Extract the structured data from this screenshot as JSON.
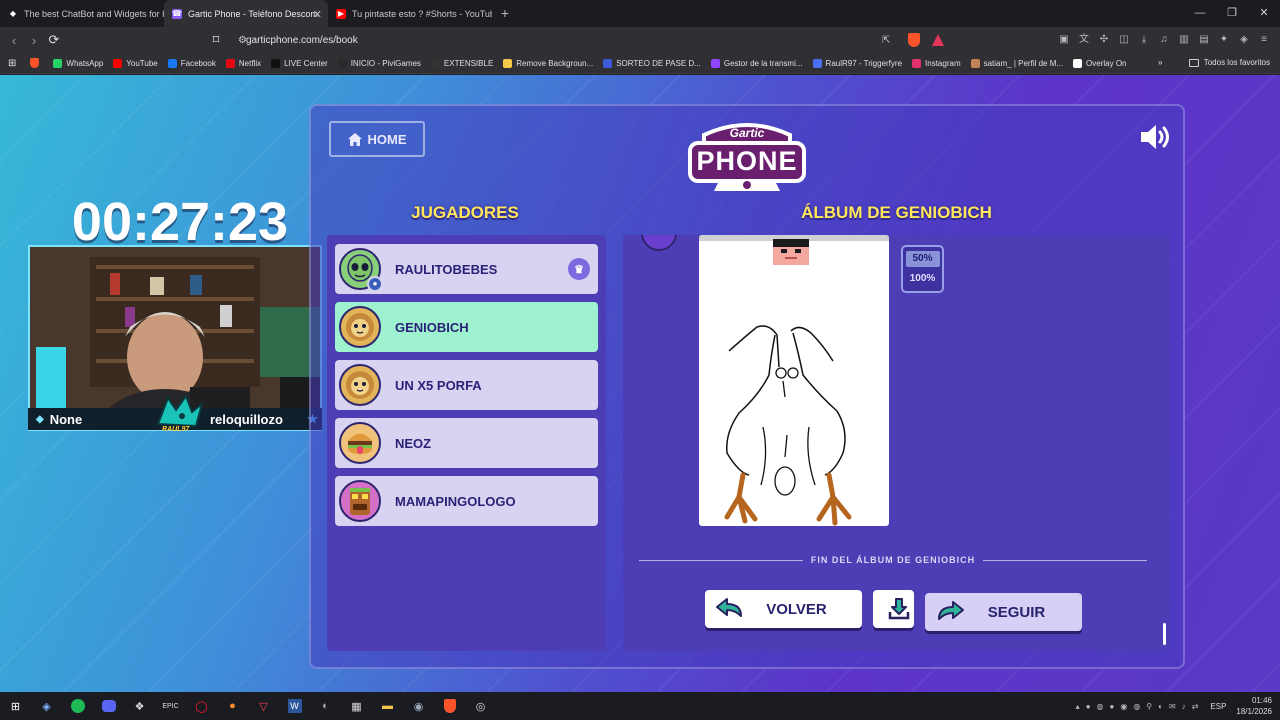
{
  "browser": {
    "tabs": [
      {
        "title": "The best ChatBot and Widgets for Ki",
        "active": false,
        "icon": "diamond-icon"
      },
      {
        "title": "Gartic Phone - Teléfono Descom",
        "active": true,
        "icon": "phone-icon"
      },
      {
        "title": "Tu pintaste esto ? #Shorts - YouTube",
        "active": false,
        "icon": "youtube-icon"
      }
    ],
    "url": "garticphone.com/es/book",
    "bookmarks": [
      {
        "label": "WhatsApp",
        "color": "#25d366"
      },
      {
        "label": "YouTube",
        "color": "#ff0000"
      },
      {
        "label": "Facebook",
        "color": "#1877f2"
      },
      {
        "label": "Netflix",
        "color": "#e50914"
      },
      {
        "label": "LIVE Center",
        "color": "#111111"
      },
      {
        "label": "INICIO - PiviGames",
        "color": "#2a2a2a"
      },
      {
        "label": "EXTENSIBLE",
        "color": "#333333"
      },
      {
        "label": "Remove Backgroun...",
        "color": "#f7c948"
      },
      {
        "label": "SORTEO DE PASE D...",
        "color": "#3b5bdb"
      },
      {
        "label": "Gestor de la transmi...",
        "color": "#9146ff"
      },
      {
        "label": "RaulR97 - Triggerfyre",
        "color": "#4c6ef5"
      },
      {
        "label": "Instagram",
        "color": "#e1306c"
      },
      {
        "label": "satiam_ | Perfil de M...",
        "color": "#c08457"
      },
      {
        "label": "Overlay On",
        "color": "#ffffff"
      }
    ],
    "bookmarks_all": "Todos los favoritos"
  },
  "game": {
    "home_label": "HOME",
    "logo_top": "Gartic",
    "logo_bottom": "PHONE",
    "players_heading": "JUGADORES",
    "album_heading": "ÁLBUM DE GENIOBICH",
    "players": [
      {
        "name": "RAULITOBEBES",
        "host": true,
        "current": false,
        "avatar": "alien"
      },
      {
        "name": "GENIOBICH",
        "host": false,
        "current": true,
        "avatar": "lion"
      },
      {
        "name": "UN X5 PORFA",
        "host": false,
        "current": false,
        "avatar": "lion"
      },
      {
        "name": "NEOZ",
        "host": false,
        "current": false,
        "avatar": "burger"
      },
      {
        "name": "MAMAPINGOLOGO",
        "host": false,
        "current": false,
        "avatar": "tiki"
      }
    ],
    "zoom_options": [
      "50%",
      "100%"
    ],
    "zoom_selected": "50%",
    "album_end": "FIN DEL ÁLBUM DE GENIOBICH",
    "back_label": "VOLVER",
    "next_label": "SEGUIR"
  },
  "stream_overlay": {
    "timer": "00:27:23",
    "left_name": "None",
    "right_name": "reloquillozo",
    "logo_text": "RAUL97"
  },
  "taskbar": {
    "language": "ESP",
    "time": "01:46",
    "date": "18/1/2026"
  }
}
